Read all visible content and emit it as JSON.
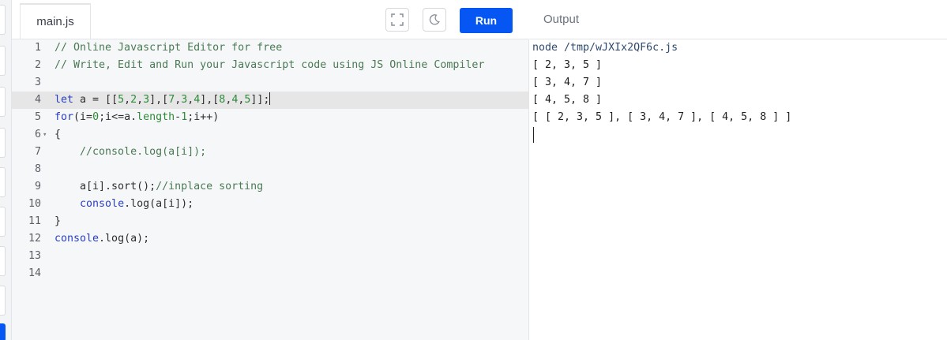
{
  "editor": {
    "file_tab": "main.js",
    "icons": {
      "fullscreen": "fullscreen-icon",
      "theme": "moon-icon"
    },
    "run_label": "Run",
    "active_line": 4,
    "lines": [
      {
        "num": "1",
        "tokens": [
          {
            "t": "// Online Javascript Editor for free",
            "c": "c-com"
          }
        ]
      },
      {
        "num": "2",
        "tokens": [
          {
            "t": "// Write, Edit and Run your Javascript code using JS Online Compiler",
            "c": "c-com"
          }
        ]
      },
      {
        "num": "3",
        "tokens": []
      },
      {
        "num": "4",
        "tokens": [
          {
            "t": "let",
            "c": "c-kw"
          },
          {
            "t": " a = [[",
            "c": "c-plain"
          },
          {
            "t": "5",
            "c": "c-num"
          },
          {
            "t": ",",
            "c": "c-plain"
          },
          {
            "t": "2",
            "c": "c-num"
          },
          {
            "t": ",",
            "c": "c-plain"
          },
          {
            "t": "3",
            "c": "c-num"
          },
          {
            "t": "],[",
            "c": "c-plain"
          },
          {
            "t": "7",
            "c": "c-num"
          },
          {
            "t": ",",
            "c": "c-plain"
          },
          {
            "t": "3",
            "c": "c-num"
          },
          {
            "t": ",",
            "c": "c-plain"
          },
          {
            "t": "4",
            "c": "c-num"
          },
          {
            "t": "],[",
            "c": "c-plain"
          },
          {
            "t": "8",
            "c": "c-num"
          },
          {
            "t": ",",
            "c": "c-plain"
          },
          {
            "t": "4",
            "c": "c-num"
          },
          {
            "t": ",",
            "c": "c-plain"
          },
          {
            "t": "5",
            "c": "c-num"
          },
          {
            "t": "]];",
            "c": "c-plain"
          }
        ]
      },
      {
        "num": "5",
        "tokens": [
          {
            "t": "for",
            "c": "c-kw"
          },
          {
            "t": "(i=",
            "c": "c-plain"
          },
          {
            "t": "0",
            "c": "c-num"
          },
          {
            "t": ";i<=a.",
            "c": "c-plain"
          },
          {
            "t": "length",
            "c": "c-num"
          },
          {
            "t": "-",
            "c": "c-plain"
          },
          {
            "t": "1",
            "c": "c-num"
          },
          {
            "t": ";i++)",
            "c": "c-plain"
          }
        ]
      },
      {
        "num": "6",
        "fold": "▾",
        "tokens": [
          {
            "t": "{",
            "c": "c-plain"
          }
        ]
      },
      {
        "num": "7",
        "tokens": [
          {
            "t": "    //console.log(a[i]);",
            "c": "c-com"
          }
        ]
      },
      {
        "num": "8",
        "tokens": []
      },
      {
        "num": "9",
        "tokens": [
          {
            "t": "    a[i].sort();",
            "c": "c-plain"
          },
          {
            "t": "//inplace sorting",
            "c": "c-com"
          }
        ]
      },
      {
        "num": "10",
        "tokens": [
          {
            "t": "    ",
            "c": "c-plain"
          },
          {
            "t": "console",
            "c": "c-fn"
          },
          {
            "t": ".log(a[i]);",
            "c": "c-plain"
          }
        ]
      },
      {
        "num": "11",
        "tokens": [
          {
            "t": "}",
            "c": "c-plain"
          }
        ]
      },
      {
        "num": "12",
        "tokens": [
          {
            "t": "console",
            "c": "c-fn"
          },
          {
            "t": ".log(a);",
            "c": "c-plain"
          }
        ]
      },
      {
        "num": "13",
        "tokens": []
      },
      {
        "num": "14",
        "tokens": []
      }
    ]
  },
  "output": {
    "title": "Output",
    "lines": [
      "node /tmp/wJXIx2QF6c.js",
      "[ 2, 3, 5 ]",
      "[ 3, 4, 7 ]",
      "[ 4, 5, 8 ]",
      "[ [ 2, 3, 5 ], [ 3, 4, 7 ], [ 4, 5, 8 ] ]"
    ]
  },
  "colors": {
    "accent": "#0556f3",
    "editor_bg": "#f6f7f8",
    "active_line_bg": "#e6e6e7"
  }
}
